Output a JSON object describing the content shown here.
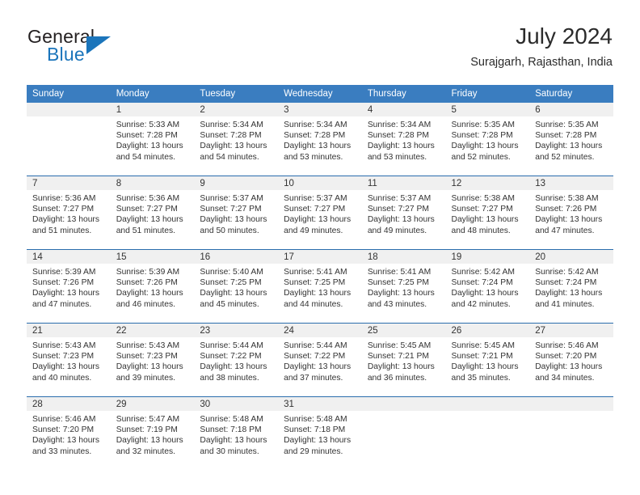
{
  "brand": {
    "name_top": "General",
    "name_bottom": "Blue",
    "accent_color": "#1b75bb"
  },
  "header": {
    "title": "July 2024",
    "subtitle": "Surajgarh, Rajasthan, India"
  },
  "theme": {
    "header_row_bg": "#3a7dc0",
    "row_divider": "#2a6dad",
    "daynum_band_bg": "#f0f0f0",
    "text": "#333333"
  },
  "weekday_headers": [
    "Sunday",
    "Monday",
    "Tuesday",
    "Wednesday",
    "Thursday",
    "Friday",
    "Saturday"
  ],
  "weeks": [
    [
      {
        "day": "",
        "sunrise": "",
        "sunset": "",
        "daylight": "",
        "empty": true
      },
      {
        "day": "1",
        "sunrise": "Sunrise: 5:33 AM",
        "sunset": "Sunset: 7:28 PM",
        "daylight": "Daylight: 13 hours and 54 minutes."
      },
      {
        "day": "2",
        "sunrise": "Sunrise: 5:34 AM",
        "sunset": "Sunset: 7:28 PM",
        "daylight": "Daylight: 13 hours and 54 minutes."
      },
      {
        "day": "3",
        "sunrise": "Sunrise: 5:34 AM",
        "sunset": "Sunset: 7:28 PM",
        "daylight": "Daylight: 13 hours and 53 minutes."
      },
      {
        "day": "4",
        "sunrise": "Sunrise: 5:34 AM",
        "sunset": "Sunset: 7:28 PM",
        "daylight": "Daylight: 13 hours and 53 minutes."
      },
      {
        "day": "5",
        "sunrise": "Sunrise: 5:35 AM",
        "sunset": "Sunset: 7:28 PM",
        "daylight": "Daylight: 13 hours and 52 minutes."
      },
      {
        "day": "6",
        "sunrise": "Sunrise: 5:35 AM",
        "sunset": "Sunset: 7:28 PM",
        "daylight": "Daylight: 13 hours and 52 minutes."
      }
    ],
    [
      {
        "day": "7",
        "sunrise": "Sunrise: 5:36 AM",
        "sunset": "Sunset: 7:27 PM",
        "daylight": "Daylight: 13 hours and 51 minutes."
      },
      {
        "day": "8",
        "sunrise": "Sunrise: 5:36 AM",
        "sunset": "Sunset: 7:27 PM",
        "daylight": "Daylight: 13 hours and 51 minutes."
      },
      {
        "day": "9",
        "sunrise": "Sunrise: 5:37 AM",
        "sunset": "Sunset: 7:27 PM",
        "daylight": "Daylight: 13 hours and 50 minutes."
      },
      {
        "day": "10",
        "sunrise": "Sunrise: 5:37 AM",
        "sunset": "Sunset: 7:27 PM",
        "daylight": "Daylight: 13 hours and 49 minutes."
      },
      {
        "day": "11",
        "sunrise": "Sunrise: 5:37 AM",
        "sunset": "Sunset: 7:27 PM",
        "daylight": "Daylight: 13 hours and 49 minutes."
      },
      {
        "day": "12",
        "sunrise": "Sunrise: 5:38 AM",
        "sunset": "Sunset: 7:27 PM",
        "daylight": "Daylight: 13 hours and 48 minutes."
      },
      {
        "day": "13",
        "sunrise": "Sunrise: 5:38 AM",
        "sunset": "Sunset: 7:26 PM",
        "daylight": "Daylight: 13 hours and 47 minutes."
      }
    ],
    [
      {
        "day": "14",
        "sunrise": "Sunrise: 5:39 AM",
        "sunset": "Sunset: 7:26 PM",
        "daylight": "Daylight: 13 hours and 47 minutes."
      },
      {
        "day": "15",
        "sunrise": "Sunrise: 5:39 AM",
        "sunset": "Sunset: 7:26 PM",
        "daylight": "Daylight: 13 hours and 46 minutes."
      },
      {
        "day": "16",
        "sunrise": "Sunrise: 5:40 AM",
        "sunset": "Sunset: 7:25 PM",
        "daylight": "Daylight: 13 hours and 45 minutes."
      },
      {
        "day": "17",
        "sunrise": "Sunrise: 5:41 AM",
        "sunset": "Sunset: 7:25 PM",
        "daylight": "Daylight: 13 hours and 44 minutes."
      },
      {
        "day": "18",
        "sunrise": "Sunrise: 5:41 AM",
        "sunset": "Sunset: 7:25 PM",
        "daylight": "Daylight: 13 hours and 43 minutes."
      },
      {
        "day": "19",
        "sunrise": "Sunrise: 5:42 AM",
        "sunset": "Sunset: 7:24 PM",
        "daylight": "Daylight: 13 hours and 42 minutes."
      },
      {
        "day": "20",
        "sunrise": "Sunrise: 5:42 AM",
        "sunset": "Sunset: 7:24 PM",
        "daylight": "Daylight: 13 hours and 41 minutes."
      }
    ],
    [
      {
        "day": "21",
        "sunrise": "Sunrise: 5:43 AM",
        "sunset": "Sunset: 7:23 PM",
        "daylight": "Daylight: 13 hours and 40 minutes."
      },
      {
        "day": "22",
        "sunrise": "Sunrise: 5:43 AM",
        "sunset": "Sunset: 7:23 PM",
        "daylight": "Daylight: 13 hours and 39 minutes."
      },
      {
        "day": "23",
        "sunrise": "Sunrise: 5:44 AM",
        "sunset": "Sunset: 7:22 PM",
        "daylight": "Daylight: 13 hours and 38 minutes."
      },
      {
        "day": "24",
        "sunrise": "Sunrise: 5:44 AM",
        "sunset": "Sunset: 7:22 PM",
        "daylight": "Daylight: 13 hours and 37 minutes."
      },
      {
        "day": "25",
        "sunrise": "Sunrise: 5:45 AM",
        "sunset": "Sunset: 7:21 PM",
        "daylight": "Daylight: 13 hours and 36 minutes."
      },
      {
        "day": "26",
        "sunrise": "Sunrise: 5:45 AM",
        "sunset": "Sunset: 7:21 PM",
        "daylight": "Daylight: 13 hours and 35 minutes."
      },
      {
        "day": "27",
        "sunrise": "Sunrise: 5:46 AM",
        "sunset": "Sunset: 7:20 PM",
        "daylight": "Daylight: 13 hours and 34 minutes."
      }
    ],
    [
      {
        "day": "28",
        "sunrise": "Sunrise: 5:46 AM",
        "sunset": "Sunset: 7:20 PM",
        "daylight": "Daylight: 13 hours and 33 minutes."
      },
      {
        "day": "29",
        "sunrise": "Sunrise: 5:47 AM",
        "sunset": "Sunset: 7:19 PM",
        "daylight": "Daylight: 13 hours and 32 minutes."
      },
      {
        "day": "30",
        "sunrise": "Sunrise: 5:48 AM",
        "sunset": "Sunset: 7:18 PM",
        "daylight": "Daylight: 13 hours and 30 minutes."
      },
      {
        "day": "31",
        "sunrise": "Sunrise: 5:48 AM",
        "sunset": "Sunset: 7:18 PM",
        "daylight": "Daylight: 13 hours and 29 minutes."
      },
      {
        "day": "",
        "sunrise": "",
        "sunset": "",
        "daylight": "",
        "empty": true
      },
      {
        "day": "",
        "sunrise": "",
        "sunset": "",
        "daylight": "",
        "empty": true
      },
      {
        "day": "",
        "sunrise": "",
        "sunset": "",
        "daylight": "",
        "empty": true
      }
    ]
  ]
}
